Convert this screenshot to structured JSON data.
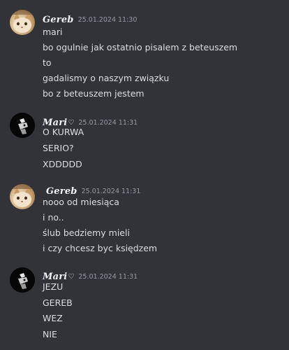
{
  "messages": [
    {
      "author": "Gereb",
      "avatar_icon": "cat-avatar-icon",
      "timestamp": "25.01.2024 11:30",
      "lines": [
        "mari",
        "bo ogulnie jak ostatnio pisalem z beteuszem",
        "to",
        "gadalismy o naszym związku",
        "bo z beteuszem jestem"
      ]
    },
    {
      "author": "Mari",
      "author_suffix": "♡",
      "avatar_icon": "dark-figure-avatar-icon",
      "timestamp": "25.01.2024 11:31",
      "lines": [
        "O KURWA",
        "SERIO?",
        "XDDDDD"
      ]
    },
    {
      "author": "Gereb",
      "avatar_icon": "cat-avatar-icon",
      "timestamp": "25.01.2024 11:31",
      "lines": [
        "nooo od miesiąca",
        "i no..",
        "ślub bedziemy mieli",
        "i czy chcesz byc księdzem"
      ]
    },
    {
      "author": "Mari",
      "author_suffix": "♡",
      "avatar_icon": "dark-figure-avatar-icon",
      "timestamp": "25.01.2024 11:31",
      "lines": [
        "JEZU",
        "GEREB",
        "WEZ",
        "NIE"
      ]
    }
  ]
}
